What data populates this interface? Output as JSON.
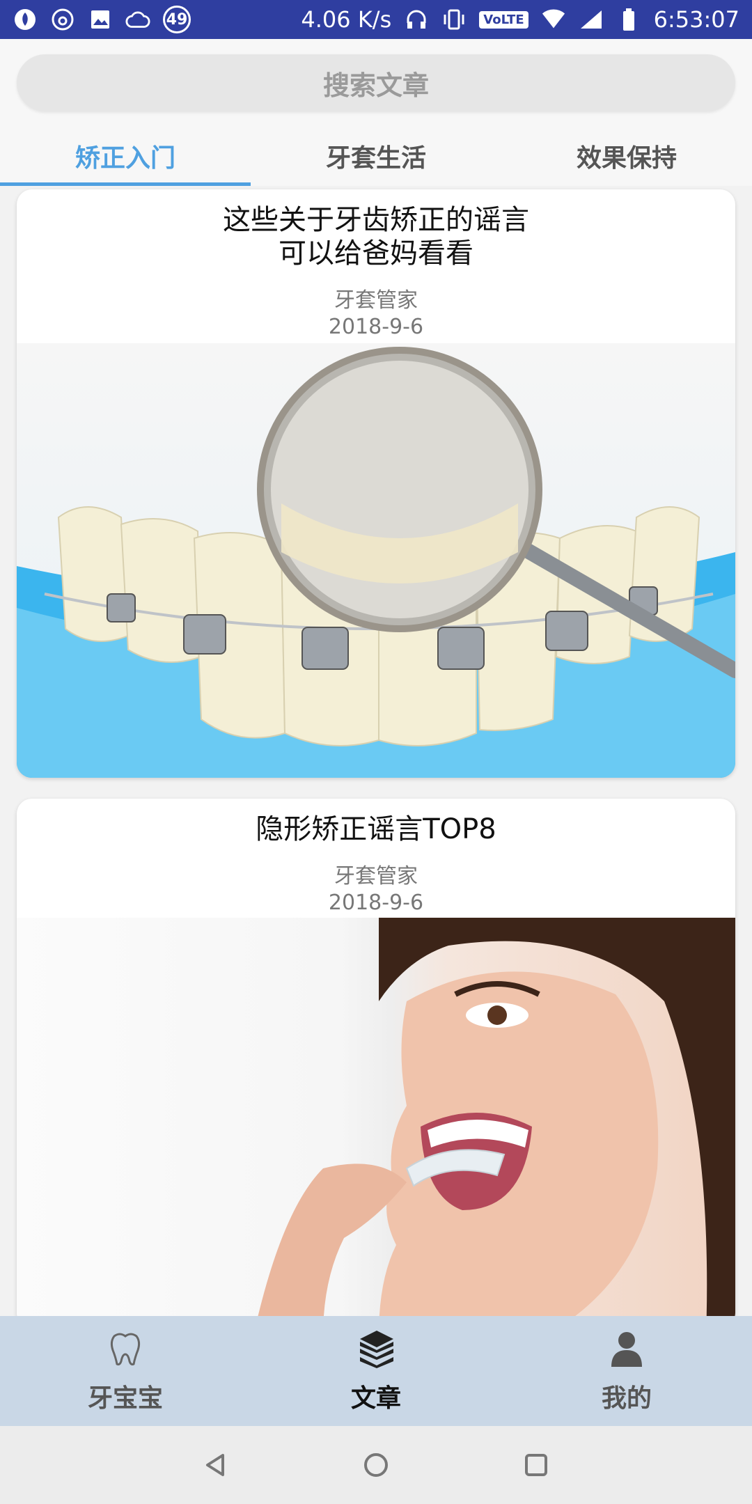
{
  "status_bar": {
    "notification_count": "49",
    "network_speed": "4.06 K/s",
    "volte": "VoLTE",
    "time": "6:53:07"
  },
  "search": {
    "placeholder": "搜索文章"
  },
  "tabs": [
    {
      "label": "矫正入门",
      "active": true
    },
    {
      "label": "牙套生活",
      "active": false
    },
    {
      "label": "效果保持",
      "active": false
    }
  ],
  "articles": [
    {
      "title_lines": [
        "这些关于牙齿矫正的谣言",
        "可以给爸妈看看"
      ],
      "author": "牙套管家",
      "date": "2018-9-6"
    },
    {
      "title_lines": [
        "隐形矫正谣言TOP8"
      ],
      "author": "牙套管家",
      "date": "2018-9-6"
    }
  ],
  "bottom_nav": [
    {
      "label": "牙宝宝",
      "icon": "tooth-icon",
      "active": false
    },
    {
      "label": "文章",
      "icon": "books-icon",
      "active": true
    },
    {
      "label": "我的",
      "icon": "person-icon",
      "active": false
    }
  ],
  "colors": {
    "status_bar": "#2f3ea0",
    "accent": "#4fa0e0",
    "bottom_nav_bg": "#c9d7e6"
  }
}
